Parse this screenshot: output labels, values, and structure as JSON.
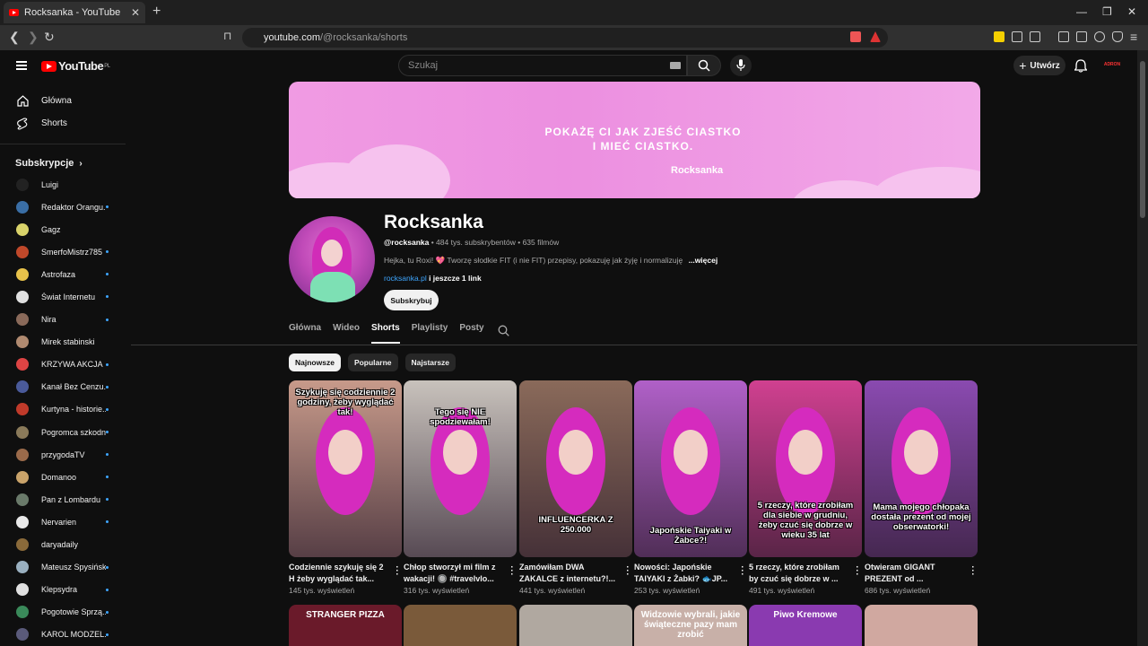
{
  "browser": {
    "tab_title": "Rocksanka - YouTube",
    "url_host": "youtube.com",
    "url_path": "/@rocksanka/shorts"
  },
  "masthead": {
    "logo_text": "YouTube",
    "logo_country": "PL",
    "search_placeholder": "Szukaj",
    "create_label": "Utwórz",
    "avatar_text": "ADRON"
  },
  "sidebar": {
    "main": [
      {
        "label": "Główna",
        "icon": "home-icon"
      },
      {
        "label": "Shorts",
        "icon": "shorts-icon"
      }
    ],
    "subs_heading": "Subskrypcje",
    "subscriptions": [
      {
        "name": "Luigi",
        "color": "#222222",
        "dot": false
      },
      {
        "name": "Redaktor Orangu...",
        "color": "#3a6ea5",
        "dot": true
      },
      {
        "name": "Gagz",
        "color": "#d9d36a",
        "dot": false
      },
      {
        "name": "SmerfoMistrz785",
        "color": "#c0482a",
        "dot": true
      },
      {
        "name": "Astrofaza",
        "color": "#e8c24a",
        "dot": true
      },
      {
        "name": "Świat Internetu",
        "color": "#e0e0e0",
        "dot": true
      },
      {
        "name": "Nira",
        "color": "#8a6a5a",
        "dot": true
      },
      {
        "name": "Mirek stabinski",
        "color": "#b08a70",
        "dot": false
      },
      {
        "name": "KRZYWA AKCJA",
        "color": "#d44",
        "dot": true
      },
      {
        "name": "Kanał Bez Cenzu...",
        "color": "#4a5a9a",
        "dot": true
      },
      {
        "name": "Kurtyna - historie...",
        "color": "#c03a2a",
        "dot": true
      },
      {
        "name": "Pogromca szkodni...",
        "color": "#8a7a5a",
        "dot": true
      },
      {
        "name": "przygodaTV",
        "color": "#9a6a4a",
        "dot": true
      },
      {
        "name": "Domanoo",
        "color": "#c9a36a",
        "dot": true
      },
      {
        "name": "Pan z Lombardu",
        "color": "#6a7a6a",
        "dot": true
      },
      {
        "name": "Nervarien",
        "color": "#e8e8e8",
        "dot": true
      },
      {
        "name": "daryadaily",
        "color": "#8a6a3a",
        "dot": false
      },
      {
        "name": "Mateusz Spysiński",
        "color": "#9ab0c0",
        "dot": true
      },
      {
        "name": "Klepsydra",
        "color": "#e0e0e0",
        "dot": true
      },
      {
        "name": "Pogotowie Sprzą...",
        "color": "#3a8a5a",
        "dot": true
      },
      {
        "name": "KAROL MODZEL...",
        "color": "#5a5a7a",
        "dot": true
      }
    ]
  },
  "banner": {
    "line1": "POKAŻĘ CI JAK ZJEŚĆ CIASTKO",
    "line2": "I MIEĆ CIASTKO.",
    "brand": "Rocksanka"
  },
  "channel": {
    "name": "Rocksanka",
    "handle": "@rocksanka",
    "meta": " • 484 tys. subskrybentów • 635 filmów",
    "description": "Hejka, tu Roxi! 💖 Tworzę słodkie FIT (i nie FIT) przepisy, pokazuję jak żyję i normalizuję",
    "more": "...więcej",
    "link": "rocksanka.pl",
    "more_links": " i jeszcze 1 link",
    "subscribe_label": "Subskrybuj"
  },
  "tabs": [
    "Główna",
    "Wideo",
    "Shorts",
    "Playlisty",
    "Posty"
  ],
  "active_tab": "Shorts",
  "chips": [
    {
      "label": "Najnowsze",
      "active": true
    },
    {
      "label": "Popularne",
      "active": false
    },
    {
      "label": "Najstarsze",
      "active": false
    }
  ],
  "shorts": [
    {
      "caption": "Szykuję się codziennie 2 godziny, żeby wyglądać tak!",
      "title": "Codziennie szykuję się 2 H żeby wyglądać tak...",
      "views": "145 tys. wyświetleń",
      "bg": "#c79a8a"
    },
    {
      "caption": "Tego się NIE spodziewałam!",
      "title": "Chłop stworzył mi film z wakacji! 🔘 #travelvlo...",
      "views": "316 tys. wyświetleń",
      "bg": "#c8c2bc"
    },
    {
      "caption": "INFLUENCERKA Z 250.000",
      "title": "Zamówiłam DWA ZAKALCE z internetu?!...",
      "views": "441 tys. wyświetleń",
      "bg": "#8a6a5a"
    },
    {
      "caption": "Japońskie Taiyaki w Żabce?!",
      "title": "Nowości: Japońskie TAIYAKI z Żabki? 🐟JP...",
      "views": "253 tys. wyświetleń",
      "bg": "#b060c8"
    },
    {
      "caption": "5 rzeczy, które zrobiłam dla siebie w grudniu, żeby czuć się dobrze w wieku 35 lat",
      "title": "5 rzeczy, które zrobiłam by czuć się dobrze w ...",
      "views": "491 tys. wyświetleń",
      "bg": "#d04090"
    },
    {
      "caption": "Mama mojego chłopaka dostała prezent od mojej obserwatorki!",
      "title": "Otwieram GIGANT PREZENT od ...",
      "views": "686 tys. wyświetleń",
      "bg": "#8a4ab0"
    }
  ],
  "row2": [
    {
      "caption": "STRANGER PIZZA",
      "bg": "#6a1a2a"
    },
    {
      "caption": "",
      "bg": "#7a5a3a"
    },
    {
      "caption": "",
      "bg": "#b0a8a0"
    },
    {
      "caption": "Widzowie wybrali, jakie świąteczne pazy mam zrobić",
      "bg": "#c8b0a8"
    },
    {
      "caption": "Piwo Kremowe",
      "bg": "#8a3ab0"
    },
    {
      "caption": "",
      "bg": "#d0a8a0"
    }
  ]
}
